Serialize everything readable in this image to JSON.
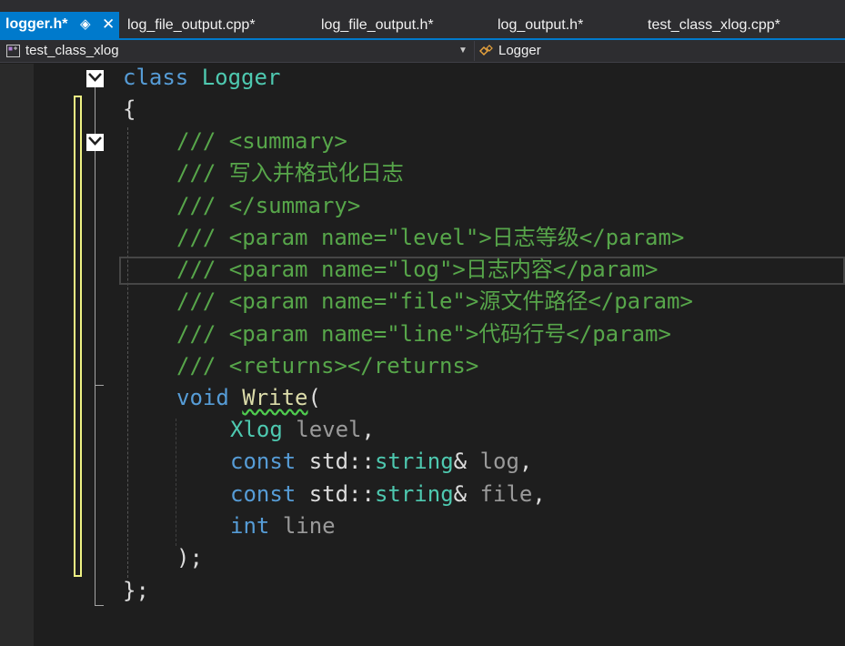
{
  "tabs": [
    {
      "label": "logger.h*",
      "active": true
    },
    {
      "label": "log_file_output.cpp*",
      "active": false
    },
    {
      "label": "log_file_output.h*",
      "active": false
    },
    {
      "label": "log_output.h*",
      "active": false
    },
    {
      "label": "test_class_xlog.cpp*",
      "active": false
    }
  ],
  "tab_pin_glyph": "◈",
  "tab_close_glyph": "✕",
  "navbar": {
    "project": "test_class_xlog",
    "project_icon": "project-icon",
    "symbol": "Logger",
    "symbol_icon": "class-icon"
  },
  "code": {
    "l1_kw": "class",
    "l1_name": "Logger",
    "l2": "{",
    "l3": "/// <summary>",
    "l4": "/// 写入并格式化日志",
    "l5": "/// </summary>",
    "l6": "/// <param name=\"level\">日志等级</param>",
    "l7": "/// <param name=\"log\">日志内容</param>",
    "l8": "/// <param name=\"file\">源文件路径</param>",
    "l9": "/// <param name=\"line\">代码行号</param>",
    "l10": "/// <returns></returns>",
    "l11_kw": "void",
    "l11_fn": "Write",
    "l11_paren": "(",
    "l12_type": "Xlog",
    "l12_param": "level",
    "l12_punct": ",",
    "l13_kw": "const",
    "l13_ns": "std::",
    "l13_type": "string",
    "l13_amp": "&",
    "l13_param": "log",
    "l13_punct": ",",
    "l14_kw": "const",
    "l14_ns": "std::",
    "l14_type": "string",
    "l14_amp": "&",
    "l14_param": "file",
    "l14_punct": ",",
    "l15_kw": "int",
    "l15_param": "line",
    "l16": ");",
    "l17": "};"
  },
  "colors": {
    "accent": "#007acc",
    "keyword": "#569cd6",
    "type": "#4ec9b0",
    "comment": "#57a64a",
    "function": "#dcdcaa",
    "change_marker": "#eff284"
  }
}
